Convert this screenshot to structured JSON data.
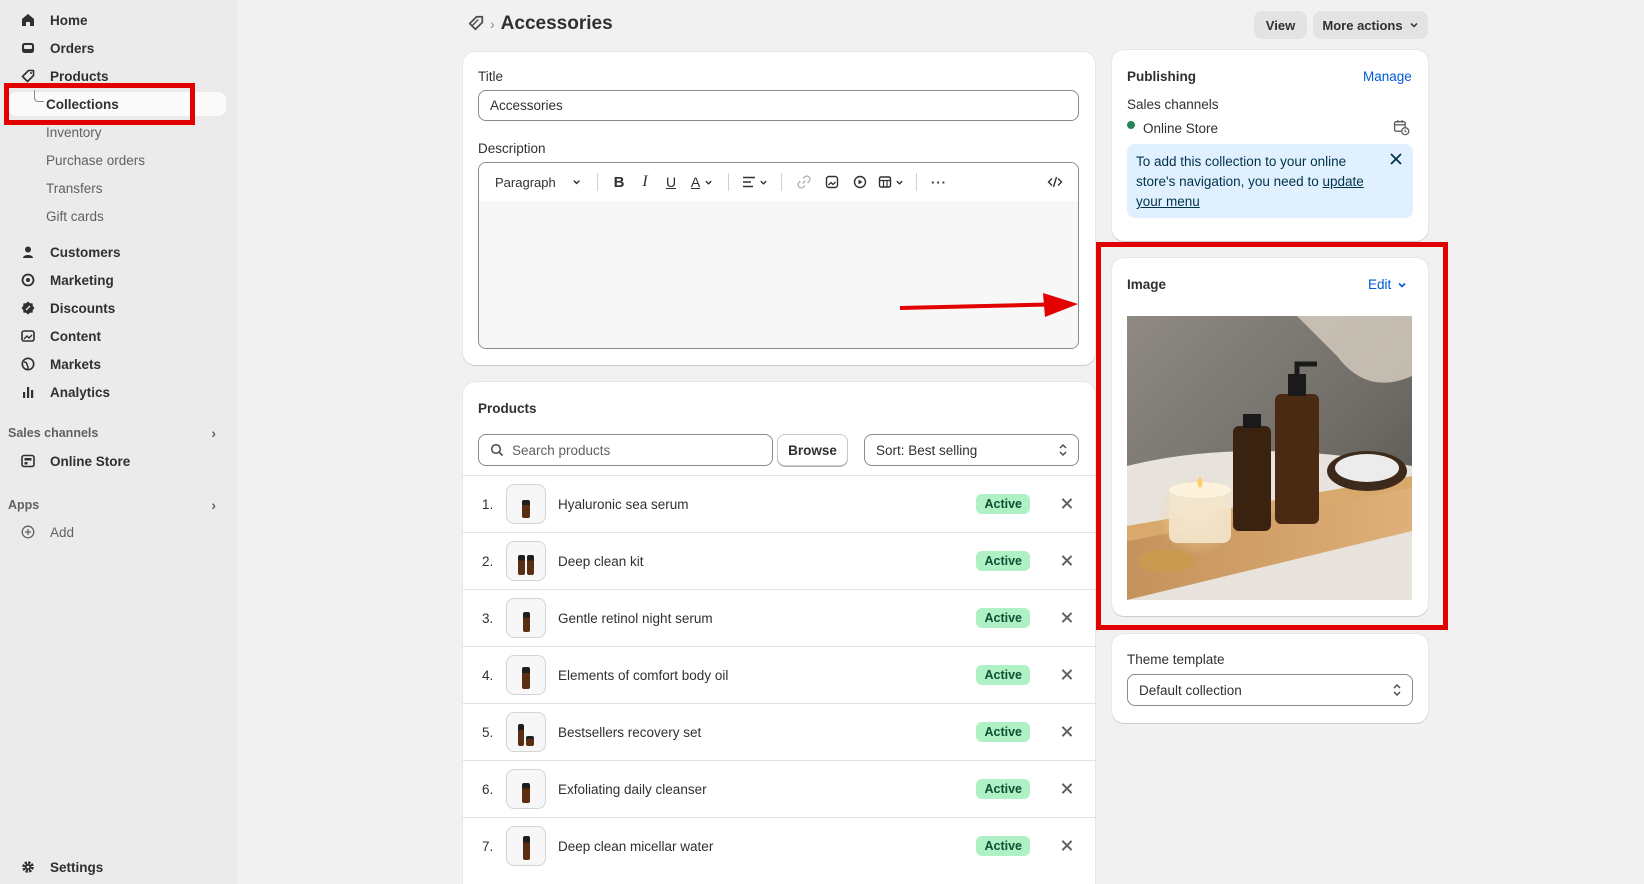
{
  "sidebar": {
    "nav": {
      "home": "Home",
      "orders": "Orders",
      "products": "Products",
      "collections": "Collections",
      "inventory": "Inventory",
      "purchase_orders": "Purchase orders",
      "transfers": "Transfers",
      "gift_cards": "Gift cards",
      "customers": "Customers",
      "marketing": "Marketing",
      "discounts": "Discounts",
      "content": "Content",
      "markets": "Markets",
      "analytics": "Analytics"
    },
    "sales_channels_label": "Sales channels",
    "online_store": "Online Store",
    "apps_label": "Apps",
    "add_label": "Add",
    "settings": "Settings"
  },
  "header": {
    "title": "Accessories",
    "view_label": "View",
    "more_actions_label": "More actions"
  },
  "details": {
    "title_label": "Title",
    "title_value": "Accessories",
    "description_label": "Description",
    "paragraph_label": "Paragraph"
  },
  "products": {
    "heading": "Products",
    "search_placeholder": "Search products",
    "browse_label": "Browse",
    "sort_label": "Sort: Best selling",
    "items": [
      {
        "num": "1.",
        "name": "Hyaluronic sea serum",
        "status": "Active"
      },
      {
        "num": "2.",
        "name": "Deep clean kit",
        "status": "Active"
      },
      {
        "num": "3.",
        "name": "Gentle retinol night serum",
        "status": "Active"
      },
      {
        "num": "4.",
        "name": "Elements of comfort body oil",
        "status": "Active"
      },
      {
        "num": "5.",
        "name": "Bestsellers recovery set",
        "status": "Active"
      },
      {
        "num": "6.",
        "name": "Exfoliating daily cleanser",
        "status": "Active"
      },
      {
        "num": "7.",
        "name": "Deep clean micellar water",
        "status": "Active"
      }
    ]
  },
  "publishing": {
    "heading": "Publishing",
    "manage_label": "Manage",
    "sales_channels_label": "Sales channels",
    "channel_name": "Online Store",
    "channel_status_color": "#29845a",
    "banner_text": "To add this collection to your online store's navigation, you need to ",
    "banner_link": "update your menu"
  },
  "image_card": {
    "heading": "Image",
    "edit_label": "Edit"
  },
  "theme": {
    "label": "Theme template",
    "value": "Default collection"
  },
  "colors": {
    "accent": "#005bd3",
    "annotation_red": "#e30000",
    "active_badge_bg": "#aff0c5"
  }
}
